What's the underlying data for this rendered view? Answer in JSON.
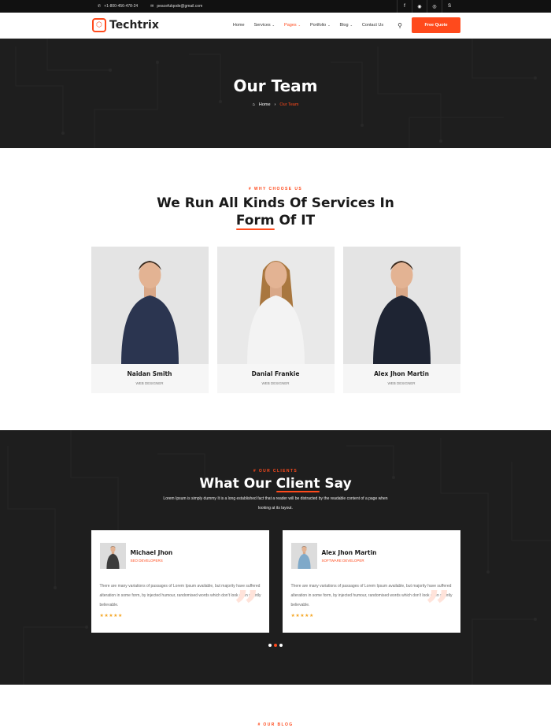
{
  "topbar": {
    "phone": "+1-800-456-478-24",
    "email": "peacefulqode@gmail.com",
    "social": [
      {
        "icon": "facebook-icon",
        "glyph": "f"
      },
      {
        "icon": "github-icon",
        "glyph": "◉"
      },
      {
        "icon": "instagram-icon",
        "glyph": "◎"
      },
      {
        "icon": "skype-icon",
        "glyph": "S"
      }
    ]
  },
  "nav": {
    "logo": "Techtrix",
    "items": [
      "Home",
      "Services",
      "Pages",
      "Portfolio",
      "Blog",
      "Contact Us"
    ],
    "active": "Pages",
    "quote_button": "Free Quote"
  },
  "hero": {
    "title": "Our Team",
    "crumb_home": "Home",
    "crumb_current": "Our Team"
  },
  "team": {
    "eyebrow": "# WHY CHOOSE US",
    "title_line1": "We Run All Kinds Of Services In",
    "title_word": "Form",
    "title_rest": " Of IT",
    "members": [
      {
        "name": "Naidan Smith",
        "role": "WEB DESIGNER",
        "shirt": "#2b3550",
        "bg": "#e4e4e4"
      },
      {
        "name": "Danial Frankie",
        "role": "WEB DESIGNER",
        "shirt": "#f3f3f3",
        "bg": "#e9e9e9"
      },
      {
        "name": "Alex Jhon Martin",
        "role": "WEB DESIGNER",
        "shirt": "#1e2433",
        "bg": "#e4e4e4"
      }
    ]
  },
  "clients": {
    "eyebrow": "# OUR CLIENTS",
    "title_pre": "What Our ",
    "title_word": "Client",
    "title_post": " Say",
    "desc": "Lorem Ipsum is simply dummy It is a long established fact that a reader will be distracted by the readable content of a page when looking at its layout.",
    "testimonials": [
      {
        "name": "Michael Jhon",
        "role": "SEO DEVELOPERS",
        "text": "There are many variations of passages of Lorem Ipsum available, but majority have suffered alteration in some form, by injected humour, randomised words which don't look even slightly believable.",
        "stars": "★★★★★"
      },
      {
        "name": "Alex Jhon Martin",
        "role": "SOFTWARE DEVELOPER",
        "text": "There are many variations of passages of Lorem Ipsum available, but majority have suffered alteration in some form, by injected humour, randomised words which don't look even slightly believable.",
        "stars": "★★★★★"
      }
    ],
    "quote_glyph": "”"
  },
  "blog": {
    "eyebrow": "# OUR BLOG"
  },
  "colors": {
    "accent": "#ff4a1c",
    "dark": "#1e1e1e"
  }
}
